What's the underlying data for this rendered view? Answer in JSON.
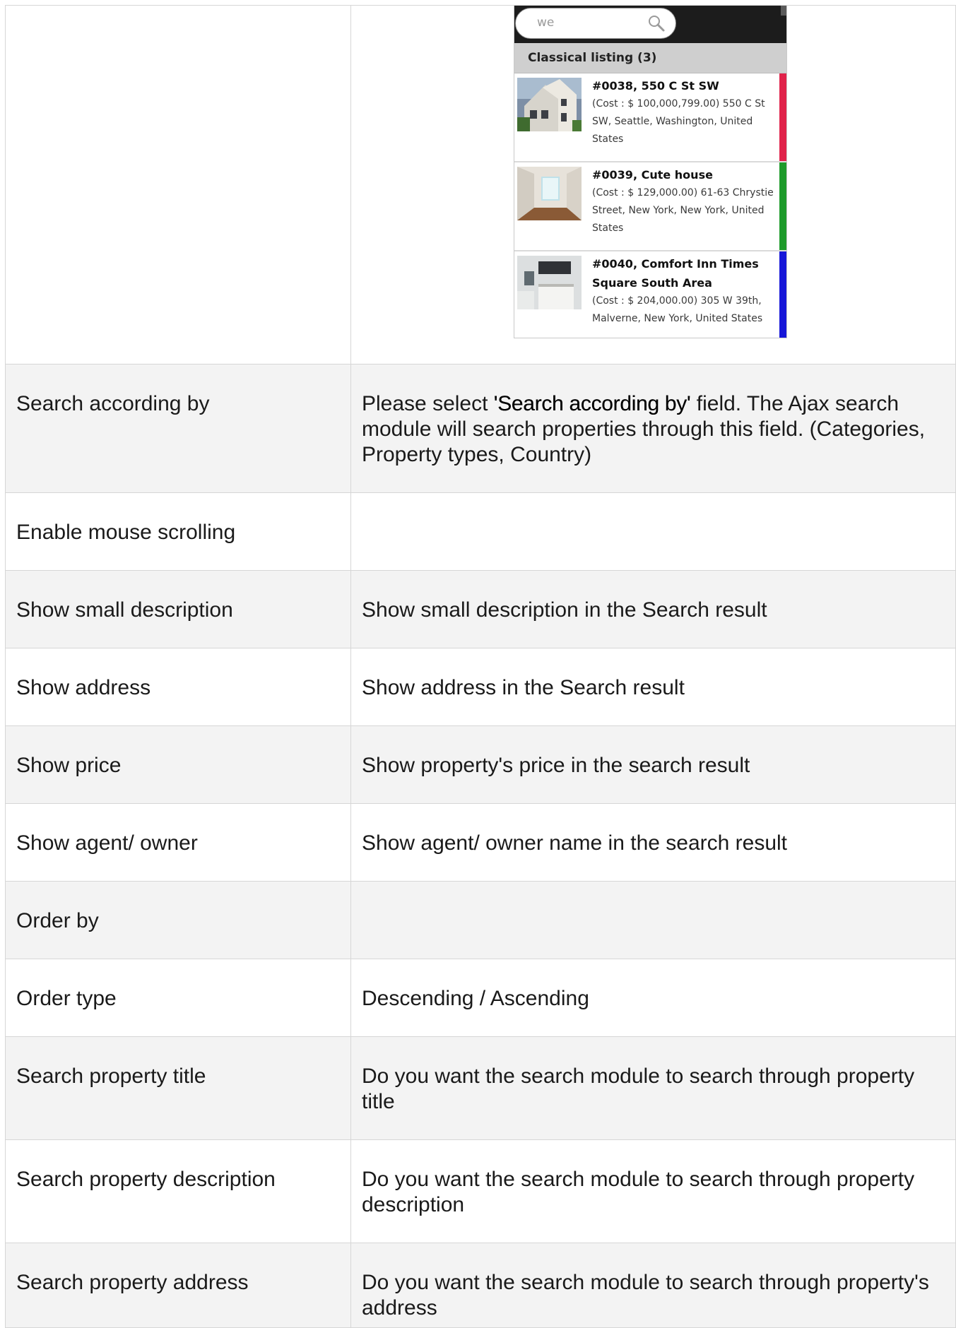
{
  "preview": {
    "search_value": "we",
    "list_header": "Classical listing (3)",
    "items": [
      {
        "title": "#0038, 550 C St SW",
        "body": "(Cost : $ 100,000,799.00) 550 C St SW, Seattle, Washington, United States",
        "accent": "#e0224a"
      },
      {
        "title": "#0039, Cute house",
        "body": "(Cost : $ 129,000.00) 61-63 Chrystie Street, New York, New York, United States",
        "accent": "#1e9a2a"
      },
      {
        "title": "#0040, Comfort Inn Times Square South Area",
        "body": "(Cost : $ 204,000.00) 305 W 39th, Malverne, New York, United States",
        "accent": "#1616d8"
      }
    ]
  },
  "rows": [
    {
      "label": "Search according by",
      "desc_pre": "Please select ",
      "desc_highlight": "'Search according by'",
      "desc_post": " field. The Ajax search module will search properties through this field. (Categories, Property types, Country)"
    },
    {
      "label": "Enable mouse scrolling",
      "desc": ""
    },
    {
      "label": "Show small description",
      "desc": "Show small description in the Search result"
    },
    {
      "label": "Show address",
      "desc": "Show address in the Search result"
    },
    {
      "label": "Show price",
      "desc": "Show property's price in the search result"
    },
    {
      "label": "Show agent/ owner",
      "desc": "Show agent/ owner name in the search result"
    },
    {
      "label": "Order by",
      "desc": ""
    },
    {
      "label": "Order type",
      "desc": "Descending / Ascending"
    },
    {
      "label": "Search property title",
      "desc": "Do you want the search module to search through property title"
    },
    {
      "label": "Search property description",
      "desc": "Do you want the search module to search through property description"
    },
    {
      "label": "Search property address",
      "desc": "Do you want the search module to search through property's address"
    }
  ]
}
